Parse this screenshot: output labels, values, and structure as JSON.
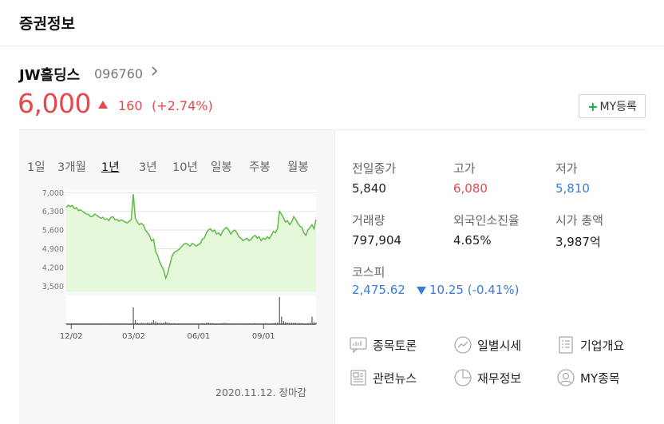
{
  "header": {
    "title": "증권정보"
  },
  "stock": {
    "name": "JW홀딩스",
    "code": "096760",
    "price": "6,000",
    "change": "160",
    "change_rate": "(+2.74%)",
    "direction": "up",
    "color_up": "#e5484d",
    "color_down": "#3a7bdc"
  },
  "my_button": {
    "label": "MY등록",
    "icon": "plus-icon"
  },
  "periods": [
    "1일",
    "3개월",
    "1년",
    "3년",
    "10년",
    "일봉",
    "주봉",
    "월봉"
  ],
  "active_period": "1년",
  "chart_data": {
    "type": "area",
    "title": "",
    "y_ticks": [
      "7,000",
      "6,300",
      "5,600",
      "4,900",
      "4,200",
      "3,500"
    ],
    "x_ticks": [
      "12/02",
      "03/02",
      "06/01",
      "09/01"
    ],
    "ylim": [
      3300,
      7100
    ],
    "price_values": [
      6450,
      6530,
      6480,
      6520,
      6400,
      6440,
      6330,
      6360,
      6300,
      6250,
      6200,
      6180,
      6100,
      6120,
      6200,
      6150,
      6100,
      6040,
      6080,
      6000,
      6020,
      5960,
      6080,
      6100,
      5980,
      6000,
      5930,
      5980,
      5950,
      5900,
      5870,
      5920,
      6000,
      6950,
      6050,
      5900,
      5800,
      5850,
      5780,
      5600,
      5500,
      5400,
      5200,
      5250,
      4800,
      4650,
      4400,
      4250,
      4100,
      3800,
      4000,
      4300,
      4600,
      4750,
      4800,
      4850,
      4900,
      5000,
      5080,
      5100,
      5050,
      5000,
      5100,
      5060,
      5000,
      5050,
      5100,
      5250,
      5300,
      5500,
      5600,
      5650,
      5550,
      5600,
      5450,
      5500,
      5400,
      5550,
      5650,
      5700,
      5600,
      5450,
      5550,
      5600,
      5500,
      5350,
      5300,
      5200,
      5250,
      5300,
      5200,
      5250,
      5350,
      5400,
      5300,
      5350,
      5200,
      5300,
      5250,
      5350,
      5280,
      5400,
      5550,
      5500,
      5650,
      6300,
      6200,
      6050,
      5900,
      5950,
      5800,
      5900,
      6100,
      6000,
      5850,
      5750,
      5700,
      5500,
      5400,
      5600,
      5700,
      5800,
      5650,
      6000
    ],
    "volume_values": [
      0.02,
      0.03,
      0.02,
      0.02,
      0.03,
      0.02,
      0.02,
      0.02,
      0.02,
      0.03,
      0.02,
      0.02,
      0.02,
      0.02,
      0.02,
      0.02,
      0.02,
      0.03,
      0.02,
      0.02,
      0.02,
      0.02,
      0.02,
      0.02,
      0.02,
      0.02,
      0.02,
      0.02,
      0.02,
      0.02,
      0.02,
      0.02,
      0.02,
      0.62,
      0.15,
      0.05,
      0.03,
      0.05,
      0.04,
      0.03,
      0.06,
      0.04,
      0.08,
      0.15,
      0.1,
      0.06,
      0.05,
      0.04,
      0.06,
      0.09,
      0.05,
      0.04,
      0.03,
      0.04,
      0.03,
      0.03,
      0.03,
      0.03,
      0.02,
      0.03,
      0.03,
      0.03,
      0.03,
      0.02,
      0.03,
      0.02,
      0.03,
      0.04,
      0.03,
      0.05,
      0.06,
      0.04,
      0.04,
      0.03,
      0.03,
      0.03,
      0.03,
      0.04,
      0.05,
      0.04,
      0.03,
      0.03,
      0.03,
      0.03,
      0.03,
      0.03,
      0.03,
      0.03,
      0.03,
      0.03,
      0.03,
      0.02,
      0.03,
      0.04,
      0.03,
      0.03,
      0.03,
      0.03,
      0.03,
      0.03,
      0.03,
      0.03,
      0.04,
      0.05,
      0.06,
      1.0,
      0.28,
      0.12,
      0.08,
      0.06,
      0.05,
      0.05,
      0.06,
      0.05,
      0.04,
      0.04,
      0.04,
      0.03,
      0.03,
      0.04,
      0.05,
      0.28,
      0.08,
      0.06
    ],
    "line_color": "#62b84a",
    "fill_color": "#e6f8da"
  },
  "close_label": "2020.11.12. 장마감",
  "info": [
    {
      "label": "전일종가",
      "value": "5,840",
      "color": ""
    },
    {
      "label": "고가",
      "value": "6,080",
      "color": "red"
    },
    {
      "label": "저가",
      "value": "5,810",
      "color": "blue"
    },
    {
      "label": "거래량",
      "value": "797,904",
      "color": ""
    },
    {
      "label": "외국인소진율",
      "value": "4.65%",
      "color": ""
    },
    {
      "label": "시가 총액",
      "value": "3,987억",
      "color": ""
    }
  ],
  "kospi": {
    "label": "코스피",
    "value": "2,475.62",
    "change": "10.25",
    "change_rate": "(-0.41%)"
  },
  "links": [
    {
      "label": "종목토론",
      "icon": "chat-icon"
    },
    {
      "label": "일별시세",
      "icon": "trend-icon"
    },
    {
      "label": "기업개요",
      "icon": "list-icon"
    },
    {
      "label": "관련뉴스",
      "icon": "news-icon"
    },
    {
      "label": "재무정보",
      "icon": "pie-icon"
    },
    {
      "label": "MY종목",
      "icon": "user-icon"
    }
  ]
}
